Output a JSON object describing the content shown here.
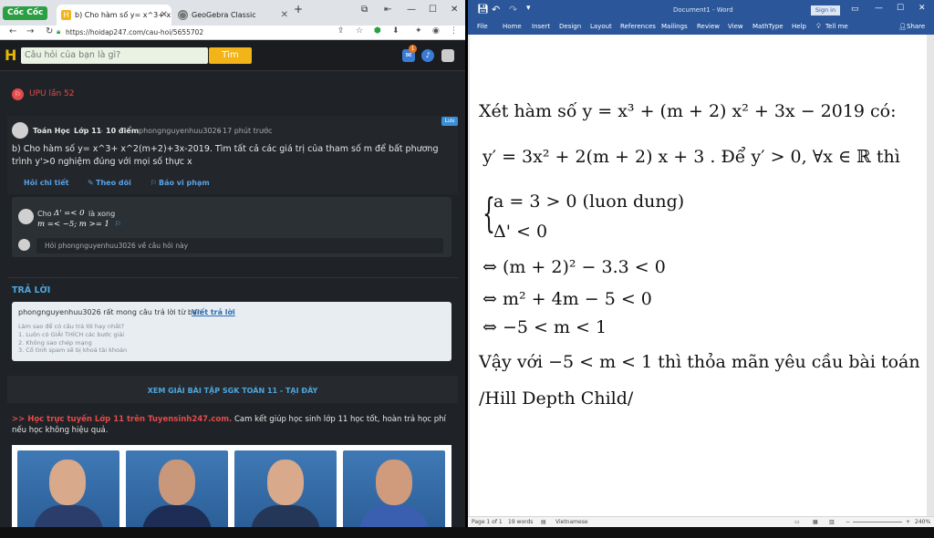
{
  "browser": {
    "brand": "Cốc Cốc",
    "tabs": [
      {
        "label": "b) Cho hàm số y= x^3+ x^2(m",
        "active": true
      },
      {
        "label": "GeoGebra Classic",
        "active": false
      }
    ],
    "new_tab_label": "+",
    "url": "https://hoidap247.com/cau-hoi/5655702"
  },
  "site": {
    "search_placeholder": "Câu hỏi của bạn là gì?",
    "search_button": "Tìm",
    "notification_count": "1",
    "upu_label": "UPU lần 52",
    "question": {
      "subject": "Toán Học",
      "grade": "Lớp 11",
      "points": "10 điểm",
      "author": "phongnguyenhuu3026",
      "time": "17 phút trước",
      "save_label": "Lưu",
      "text": "b) Cho hàm số y= x^3+ x^2(m+2)+3x-2019. Tìm tất cả các giá trị của tham số m để bất phương trình y'>0 nghiệm đúng với mọi số thực x",
      "actions": [
        "Hỏi chi tiết",
        "Theo dõi",
        "Báo vi phạm"
      ]
    },
    "comment": {
      "prefix": "Cho",
      "math1": "Δ' =< 0",
      "suffix": "là xong",
      "math2": "m =< −5; m >= 1",
      "reply_placeholder": "Hỏi phongnguyenhuu3026 về câu hỏi này"
    },
    "answers": {
      "title": "TRẢ LỜI",
      "wait_text": "phongnguyenhuu3026 rất mong câu trả lời từ bạn.",
      "write_link": "Viết trả lời",
      "tips_title": "Làm sao để có câu trả lời hay nhất?",
      "tips": [
        "1. Luôn có GIẢI THÍCH các bước giải",
        "2. Không sao chép mạng",
        "3. Cố tình spam sẽ bị khoá tài khoản"
      ]
    },
    "sgk_link": "XEM GIẢI BÀI TẬP SGK TOÁN 11 - TẠI ĐÂY",
    "promo_red": ">> Học trực tuyến Lớp 11 trên Tuyensinh247.com.",
    "promo_text": "Cam kết giúp học sinh lớp 11 học tốt, hoàn trả học phí nếu học không hiệu quả."
  },
  "word": {
    "title": "Document1 - Word",
    "sign_in": "Sign in",
    "menu": [
      "File",
      "Home",
      "Insert",
      "Design",
      "Layout",
      "References",
      "Mailings",
      "Review",
      "View",
      "MathType",
      "Help",
      "Tell me"
    ],
    "share": "Share",
    "doc_lines": [
      "Xét hàm số  y = x³ + (m + 2) x² + 3x − 2019 có:",
      "y′ = 3x² + 2(m + 2) x + 3 . Để  y′ > 0, ∀x ∈ ℝ  thì",
      "a = 3 > 0 (luon dung)",
      "Δ' < 0",
      "⇔ (m + 2)² − 3.3 < 0",
      "⇔ m² + 4m − 5 < 0",
      "⇔ −5 < m < 1",
      "Vậy với  −5 < m < 1 thì thỏa mãn yêu cầu bài toán",
      "/Hill Depth Child/"
    ],
    "status": {
      "page": "Page 1 of 1",
      "words": "19 words",
      "language": "Vietnamese",
      "zoom": "240%"
    }
  },
  "colors": {
    "word_blue": "#2b579a",
    "site_bg": "#1f2327",
    "accent_yellow": "#f2b418",
    "link_blue": "#5aa0e6",
    "red": "#e34a4a"
  }
}
